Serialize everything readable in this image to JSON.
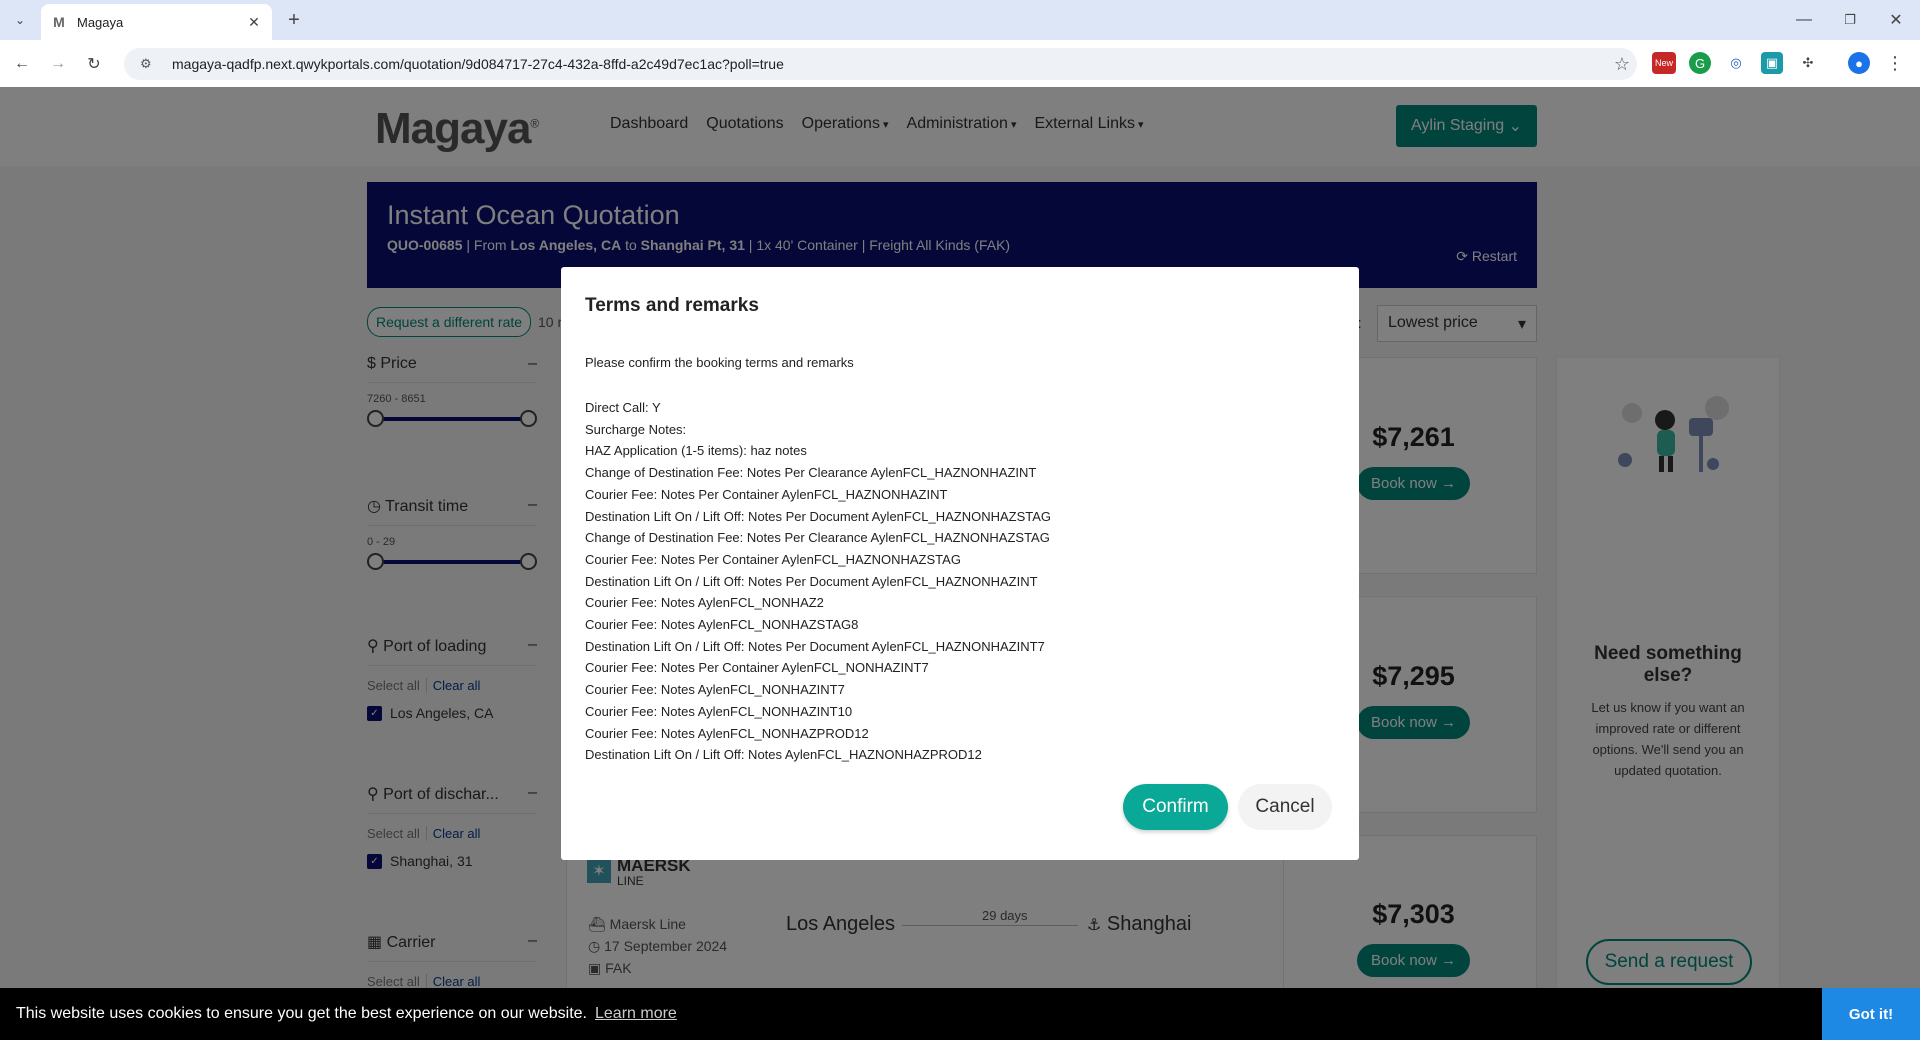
{
  "browser": {
    "tab_title": "Magaya",
    "tab_favicon": "M",
    "url": "magaya-qadfp.next.qwykportals.com/quotation/9d084717-27c4-432a-8ffd-a2c49d7ec1ac?poll=true",
    "ext_new_badge": "New"
  },
  "nav": {
    "logo": "Magaya",
    "links": [
      "Dashboard",
      "Quotations",
      "Operations",
      "Administration",
      "External Links"
    ],
    "account": "Aylin Staging"
  },
  "banner": {
    "title": "Instant Ocean Quotation",
    "quote_id": "QUO-00685",
    "from_label": " | From ",
    "origin": "Los Angeles, CA",
    "to_label": " to ",
    "destination": "Shanghai Pt, 31",
    "details": "  |  1x 40' Container | Freight All Kinds (FAK)",
    "restart": "Restart"
  },
  "toolbar": {
    "request_rate": "Request a different rate",
    "results_partial": "10 r",
    "sort_label_partial": "y:",
    "sort_value": "Lowest price"
  },
  "filters": {
    "price": {
      "title": "Price",
      "range": "7260 - 8651"
    },
    "transit": {
      "title": "Transit time",
      "range": "0 - 29"
    },
    "pol": {
      "title": "Port of loading",
      "select_all": "Select all",
      "clear_all": "Clear all",
      "option": "Los Angeles, CA"
    },
    "pod": {
      "title": "Port of dischar...",
      "select_all": "Select all",
      "clear_all": "Clear all",
      "option": "Shanghai, 31"
    },
    "carrier": {
      "title": "Carrier",
      "select_all": "Select all",
      "clear_all": "Clear all"
    }
  },
  "results": [
    {
      "price": "$7,261",
      "book": "Book now"
    },
    {
      "price": "$7,295",
      "book": "Book now"
    },
    {
      "price": "$7,303",
      "book": "Book now",
      "carrier_logo": "MAERSK",
      "carrier_logo_sub": "LINE",
      "carrier": "Maersk Line",
      "date": "17 September 2024",
      "commodity": "FAK",
      "origin": "Los Angeles",
      "transit": "29 days",
      "destination": "Shanghai"
    }
  ],
  "side": {
    "title": "Need something else?",
    "text": "Let us know if you want an improved rate or different options. We'll send you an updated quotation.",
    "button": "Send a request"
  },
  "modal": {
    "title": "Terms and remarks",
    "intro": "Please confirm the booking terms and remarks",
    "lines": [
      "Direct Call: Y",
      "Surcharge Notes:",
      "HAZ Application (1-5 items): haz notes",
      "Change of Destination Fee: Notes Per Clearance AylenFCL_HAZNONHAZINT",
      "Courier Fee: Notes Per Container AylenFCL_HAZNONHAZINT",
      "Destination Lift On / Lift Off: Notes Per Document AylenFCL_HAZNONHAZSTAG",
      "Change of Destination Fee: Notes Per Clearance AylenFCL_HAZNONHAZSTAG",
      "Courier Fee: Notes Per Container AylenFCL_HAZNONHAZSTAG",
      "Destination Lift On / Lift Off: Notes Per Document AylenFCL_HAZNONHAZINT",
      "Courier Fee: Notes AylenFCL_NONHAZ2",
      "Courier Fee: Notes AylenFCL_NONHAZSTAG8",
      "Destination Lift On / Lift Off: Notes Per Document AylenFCL_HAZNONHAZINT7",
      "Courier Fee: Notes Per Container AylenFCL_NONHAZINT7",
      "Courier Fee: Notes AylenFCL_NONHAZINT7",
      "Courier Fee: Notes AylenFCL_NONHAZINT10",
      "Courier Fee: Notes AylenFCL_NONHAZPROD12",
      "Destination Lift On / Lift Off: Notes AylenFCL_HAZNONHAZPROD12"
    ],
    "confirm": "Confirm",
    "cancel": "Cancel"
  },
  "cookie": {
    "text": "This website uses cookies to ensure you get the best experience on our website.",
    "learn_more": "Learn more",
    "got_it": "Got it!"
  },
  "colors": {
    "accent": "#00897b",
    "navy": "#0a0f70",
    "confirm": "#0aa896",
    "cookie_button": "#1e88e5"
  }
}
